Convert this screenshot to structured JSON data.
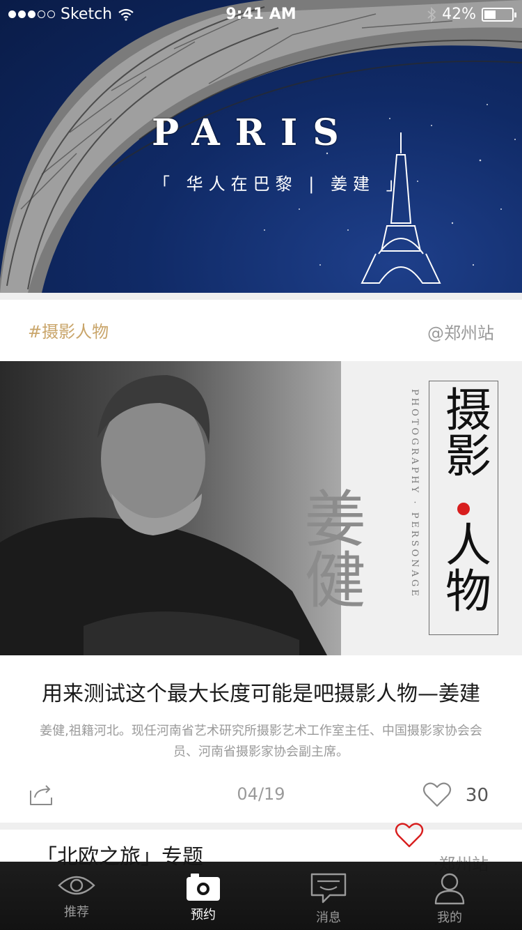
{
  "status_bar": {
    "carrier": "Sketch",
    "time": "9:41 AM",
    "battery_percent": "42%",
    "battery_level": 0.42
  },
  "banner": {
    "title": "PARIS",
    "subtitle": "「 华人在巴黎 |  姜建 」"
  },
  "card": {
    "tag": "#摄影人物",
    "station": "@郑州站",
    "image": {
      "name_vertical": "姜健",
      "title_char_1": "摄影",
      "title_char_2": "人物",
      "english_vertical": "PHOTOGRAPHY · PERSONAGE"
    },
    "title": "用来测试这个最大长度可能是吧摄影人物—姜建",
    "description": "姜健,祖籍河北。现任河南省艺术研究所摄影艺术工作室主任、中国摄影家协会会员、河南省摄影家协会副主席。",
    "pager": "04/19",
    "like_count": "30"
  },
  "card2": {
    "heading": "「北欧之旅」专题",
    "station": "·郑州站"
  },
  "tabbar": {
    "tabs": [
      {
        "label": "推荐",
        "icon": "eye-icon"
      },
      {
        "label": "预约",
        "icon": "camera-icon"
      },
      {
        "label": "消息",
        "icon": "message-icon"
      },
      {
        "label": "我的",
        "icon": "user-icon"
      }
    ],
    "active_index": 1
  },
  "colors": {
    "accent_gold": "#c9a56a",
    "banner_blue": "#102a66",
    "heart_red": "#d81e1e"
  }
}
